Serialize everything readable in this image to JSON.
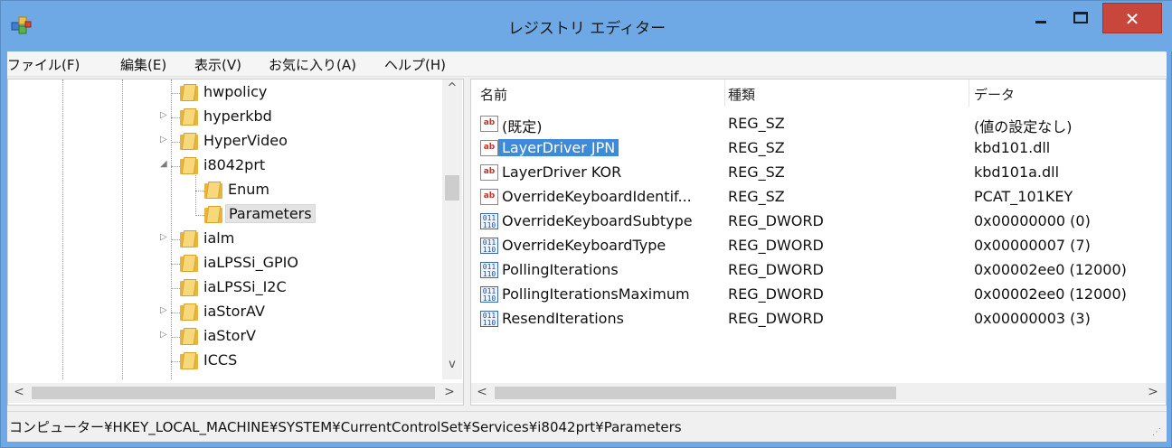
{
  "window": {
    "title": "レジストリ エディター",
    "close_label": "✕"
  },
  "menu": [
    {
      "label": "ファイル(F)"
    },
    {
      "label": "編集(E)"
    },
    {
      "label": "表示(V)"
    },
    {
      "label": "お気に入り(A)"
    },
    {
      "label": "ヘルプ(H)"
    }
  ],
  "tree": [
    {
      "label": "hwpolicy",
      "expander": ""
    },
    {
      "label": "hyperkbd",
      "expander": "▷"
    },
    {
      "label": "HyperVideo",
      "expander": "▷"
    },
    {
      "label": "i8042prt",
      "expander": "◢"
    },
    {
      "label": "Enum",
      "expander": ""
    },
    {
      "label": "Parameters",
      "expander": ""
    },
    {
      "label": "ialm",
      "expander": "▷"
    },
    {
      "label": "iaLPSSi_GPIO",
      "expander": ""
    },
    {
      "label": "iaLPSSi_I2C",
      "expander": ""
    },
    {
      "label": "iaStorAV",
      "expander": "▷"
    },
    {
      "label": "iaStorV",
      "expander": "▷"
    },
    {
      "label": "ICCS",
      "expander": ""
    }
  ],
  "list": {
    "headers": {
      "name": "名前",
      "type": "種類",
      "data": "データ"
    },
    "rows": [
      {
        "icon": "string-value-icon",
        "badge": "ab",
        "name": "(既定)",
        "type": "REG_SZ",
        "data": "(値の設定なし)"
      },
      {
        "icon": "string-value-icon",
        "badge": "ab",
        "name": "LayerDriver JPN",
        "type": "REG_SZ",
        "data": "kbd101.dll"
      },
      {
        "icon": "string-value-icon",
        "badge": "ab",
        "name": "LayerDriver KOR",
        "type": "REG_SZ",
        "data": "kbd101a.dll"
      },
      {
        "icon": "string-value-icon",
        "badge": "ab",
        "name": "OverrideKeyboardIdentif...",
        "type": "REG_SZ",
        "data": "PCAT_101KEY"
      },
      {
        "icon": "binary-value-icon",
        "badge": "011",
        "name": "OverrideKeyboardSubtype",
        "type": "REG_DWORD",
        "data": "0x00000000 (0)"
      },
      {
        "icon": "binary-value-icon",
        "badge": "011",
        "name": "OverrideKeyboardType",
        "type": "REG_DWORD",
        "data": "0x00000007 (7)"
      },
      {
        "icon": "binary-value-icon",
        "badge": "011",
        "name": "PollingIterations",
        "type": "REG_DWORD",
        "data": "0x00002ee0 (12000)"
      },
      {
        "icon": "binary-value-icon",
        "badge": "011",
        "name": "PollingIterationsMaximum",
        "type": "REG_DWORD",
        "data": "0x00002ee0 (12000)"
      },
      {
        "icon": "binary-value-icon",
        "badge": "011",
        "name": "ResendIterations",
        "type": "REG_DWORD",
        "data": "0x00000003 (3)"
      }
    ]
  },
  "status": {
    "path": "コンピューター¥HKEY_LOCAL_MACHINE¥SYSTEM¥CurrentControlSet¥Services¥i8042prt¥Parameters"
  }
}
